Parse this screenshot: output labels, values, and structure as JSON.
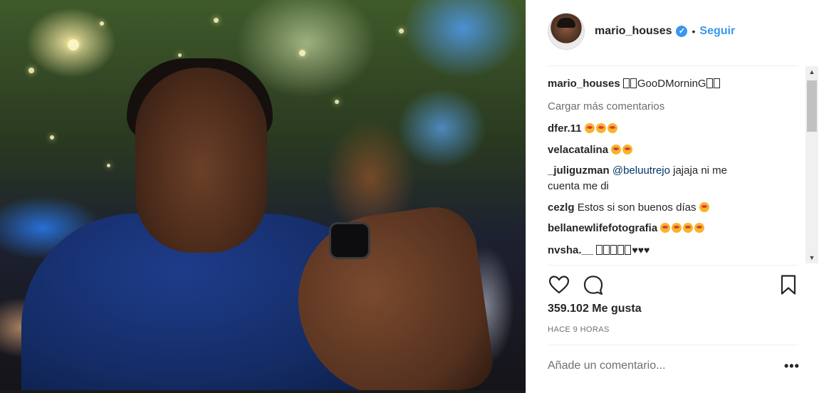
{
  "post": {
    "username": "mario_houses",
    "verified_icon": "verified-badge-icon",
    "separator": "•",
    "follow_label": "Seguir",
    "likes_text": "359.102 Me gusta",
    "time_text": "HACE 9 HORAS",
    "add_comment_placeholder": "Añade un comentario...",
    "more_label": "•••"
  },
  "caption": {
    "user": "mario_houses",
    "text": "GooDMorninG"
  },
  "load_more_label": "Cargar más comentarios",
  "comments": [
    {
      "user": "dfer.11",
      "text": ""
    },
    {
      "user": "velacatalina",
      "text": ""
    },
    {
      "user": "_juliguzman",
      "mention": "@beluutrejo",
      "text": " jajaja ni me cuenta me di"
    },
    {
      "user": "cezlg",
      "text": "Estos si son buenos días"
    },
    {
      "user": "bellanewlifefotografia",
      "text": ""
    },
    {
      "user": "nvsha.__",
      "text": "♥♥♥"
    }
  ],
  "colors": {
    "accent": "#3897f0",
    "text": "#262626",
    "muted": "#6f6f6f",
    "mention": "#003569"
  },
  "icons": [
    "heart-icon",
    "comment-icon",
    "bookmark-icon",
    "more-options-icon"
  ]
}
